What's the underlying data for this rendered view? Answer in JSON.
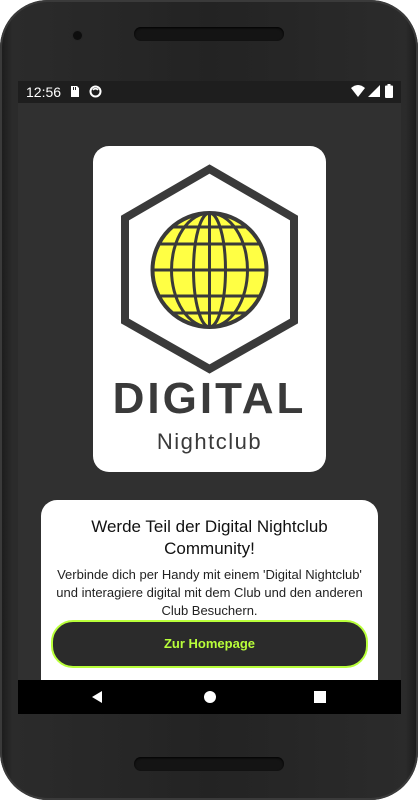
{
  "status_bar": {
    "time": "12:56",
    "icons_left": [
      "sd-card-icon",
      "sync-icon"
    ],
    "icons_right": [
      "wifi-icon",
      "cell-signal-icon",
      "battery-icon"
    ]
  },
  "logo": {
    "title": "DIGITAL",
    "subtitle": "Nightclub",
    "globe_color": "#ffff44",
    "outline_color": "#3a3a3a"
  },
  "info_card": {
    "title": "Werde Teil der Digital Nightclub Community!",
    "body": "Verbinde dich per Handy mit einem 'Digital Nightclub' und interagiere digital mit dem Club und den anderen Club Besuchern.",
    "button_label": "Zur Homepage",
    "button_color": "#b9ff3a"
  },
  "nav_bar": {
    "buttons": [
      "back-icon",
      "home-icon",
      "recents-icon"
    ]
  }
}
